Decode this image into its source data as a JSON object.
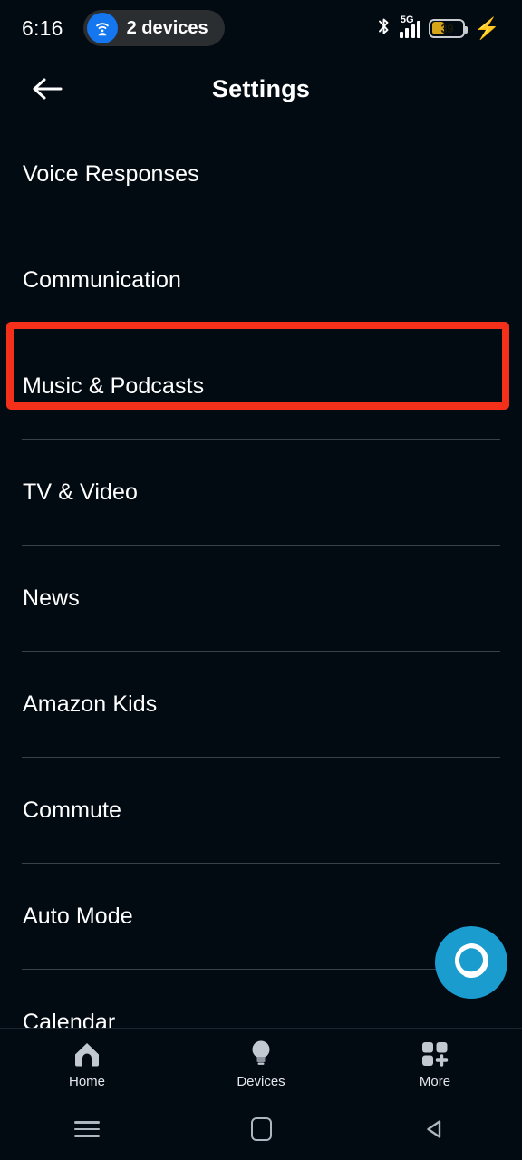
{
  "status_bar": {
    "time": "6:16",
    "hotspot_icon": "hotspot-icon",
    "hotspot_label": "2 devices",
    "bluetooth_icon": "bluetooth-icon",
    "network_type": "5G",
    "signal_icon": "signal-bars-icon",
    "battery_level": "39",
    "battery_icon": "battery-icon",
    "charging_icon": "lightning-bolt-icon",
    "colors": {
      "hotspot_accent": "#1477f0",
      "battery_fill": "#d6a419",
      "charging_bolt": "#6d5cf5"
    }
  },
  "header": {
    "back_icon": "back-arrow-icon",
    "title": "Settings"
  },
  "settings_list": {
    "items": [
      {
        "label": "Voice Responses"
      },
      {
        "label": "Communication"
      },
      {
        "label": "Music & Podcasts"
      },
      {
        "label": "TV & Video"
      },
      {
        "label": "News"
      },
      {
        "label": "Amazon Kids"
      },
      {
        "label": "Commute"
      },
      {
        "label": "Auto Mode"
      },
      {
        "label": "Calendar"
      }
    ]
  },
  "highlight": {
    "target_label": "Music & Podcasts",
    "color": "#f4301a"
  },
  "alexa_button": {
    "icon": "alexa-logo-icon",
    "color": "#1b9ccf"
  },
  "tab_bar": {
    "tabs": [
      {
        "label": "Home",
        "icon": "home-icon"
      },
      {
        "label": "Devices",
        "icon": "lightbulb-icon"
      },
      {
        "label": "More",
        "icon": "grid-plus-icon"
      }
    ]
  },
  "android_nav": {
    "recents_icon": "hamburger-menu-icon",
    "home_icon": "square-home-icon",
    "back_icon": "triangle-back-icon"
  }
}
